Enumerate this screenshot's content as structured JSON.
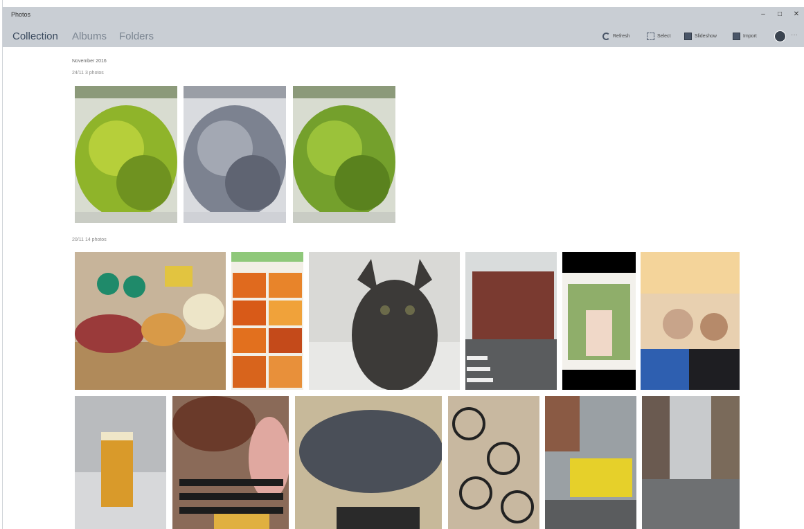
{
  "window": {
    "title": "Photos",
    "min_glyph": "–",
    "max_glyph": "□",
    "close_glyph": "✕"
  },
  "nav": {
    "tabs": [
      {
        "label": "Collection"
      },
      {
        "label": "Albums"
      },
      {
        "label": "Folders"
      }
    ]
  },
  "commands": {
    "refresh": "Refresh",
    "select": "Select",
    "slideshow": "Slideshow",
    "import": "Import",
    "more_glyph": "···"
  },
  "collection": {
    "month": "November 2016",
    "groups": [
      {
        "label": "24/11   3 photos",
        "photo_count": 3
      },
      {
        "label": "20/11   14 photos",
        "photo_count": 14
      }
    ]
  },
  "colors": {
    "chrome": "#c9ced4",
    "accent": "#3a4a5e"
  }
}
